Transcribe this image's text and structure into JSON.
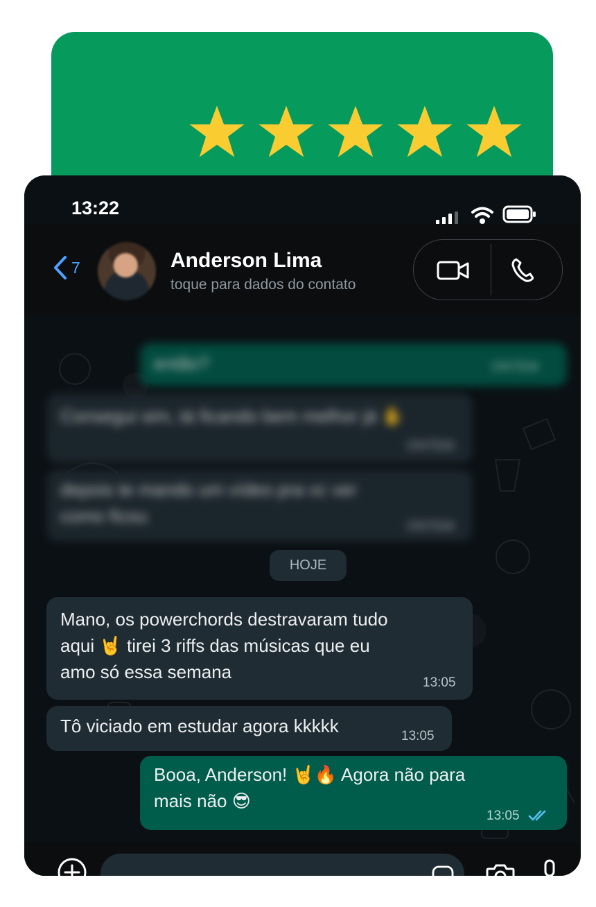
{
  "rating": {
    "stars": 5,
    "star_color": "#f9cc32",
    "card_color": "#069a5c"
  },
  "status": {
    "time": "13:22"
  },
  "header": {
    "back_count": "7",
    "contact_name": "Anderson Lima",
    "contact_subtitle": "toque para dados do contato"
  },
  "messages": {
    "blurred_1": {
      "text": "então?",
      "time": "ONTEM"
    },
    "blurred_2": {
      "text": "Consegui sim, tá ficando bem melhor já ✋",
      "time": "ONTEM"
    },
    "blurred_3": {
      "text": "depois te mando um vídeo pra vc ver como ficou",
      "time": "ONTEM"
    },
    "date": "HOJE",
    "msg1": {
      "line1": "Mano, os powerchords destravaram tudo",
      "line2": "aqui 🤘 tirei 3 riffs das músicas que eu",
      "line3": "amo só essa semana",
      "time": "13:05"
    },
    "msg2": {
      "text": "Tô viciado em estudar agora kkkkk",
      "time": "13:05"
    },
    "msg3": {
      "line1": "Booa, Anderson! 🤘🔥 Agora não para",
      "line2": "mais não 😎",
      "time": "13:05"
    }
  },
  "colors": {
    "accent": "#4da2ff",
    "incoming_bubble": "#202c33",
    "outgoing_bubble": "#005c4b",
    "read_tick": "#53bdeb"
  }
}
